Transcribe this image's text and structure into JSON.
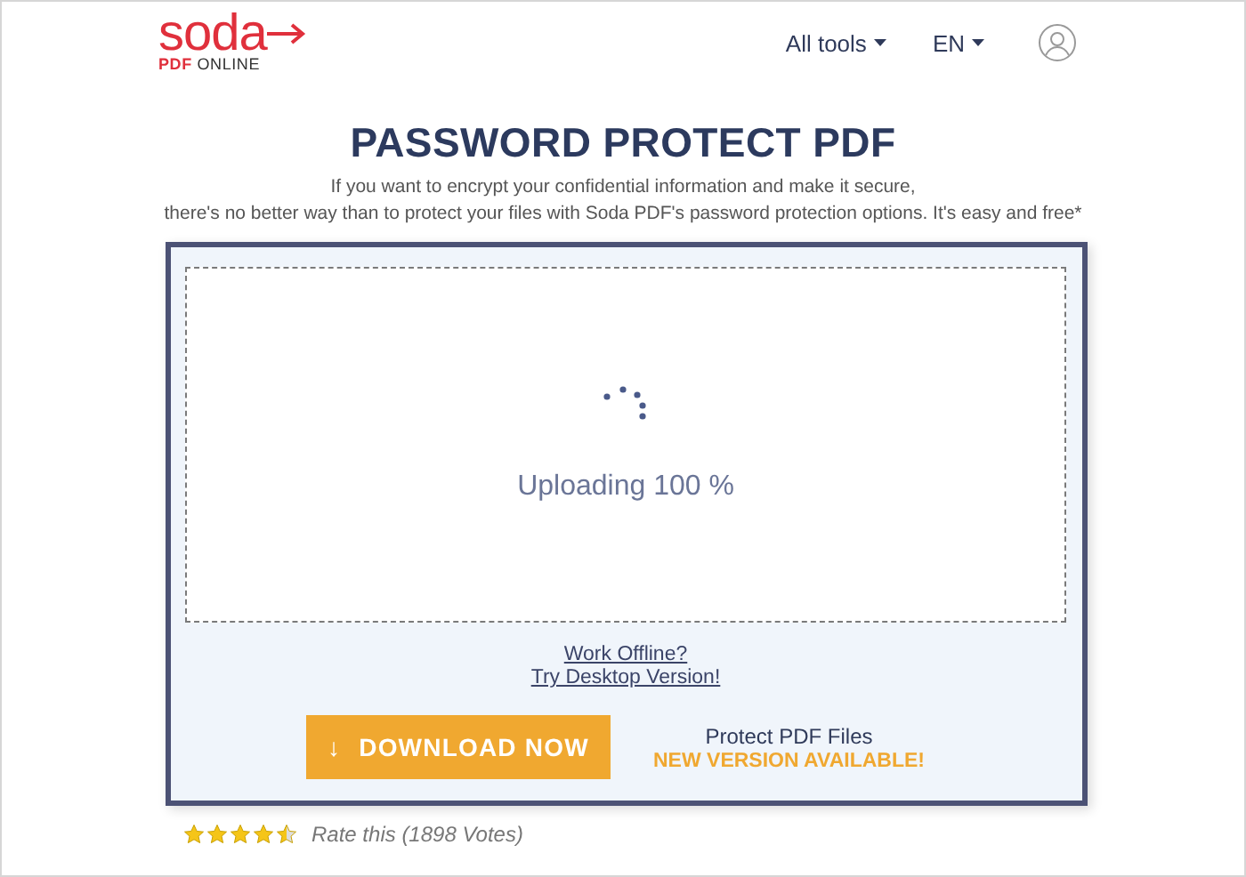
{
  "header": {
    "logo": {
      "word": "soda",
      "sub_bold": "PDF",
      "sub": "ONLINE"
    },
    "nav": [
      {
        "label": "All tools"
      },
      {
        "label": "EN"
      }
    ]
  },
  "title": "PASSWORD PROTECT PDF",
  "intro": [
    "If you want to encrypt your confidential information and make it secure,",
    "there's no better way than to protect your files with Soda PDF's password protection options. It's easy and free*"
  ],
  "upload": {
    "status": "Uploading 100 %"
  },
  "links": [
    "Work Offline?",
    "Try Desktop Version!"
  ],
  "download": {
    "icon": "↓",
    "label": "DOWNLOAD NOW",
    "product": "Protect PDF Files",
    "notice": "NEW VERSION AVAILABLE!"
  },
  "rating": {
    "stars": 4.5,
    "text": "Rate this (1898 Votes)"
  }
}
